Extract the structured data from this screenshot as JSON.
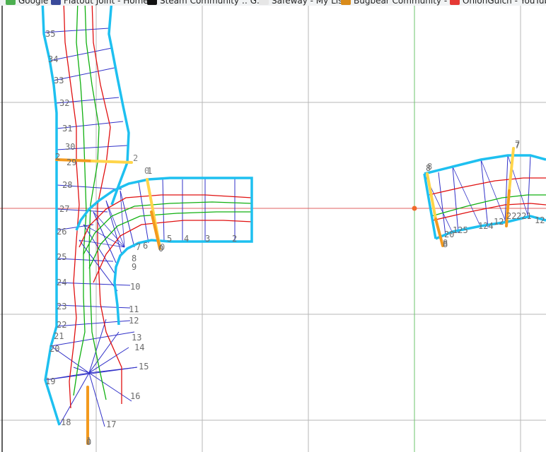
{
  "bookmarks": [
    {
      "label": "Google",
      "icon": "google-icon",
      "color": "#4caf50"
    },
    {
      "label": "Flatout Joint - Home",
      "icon": "flatout-icon",
      "color": "#3a4a9a"
    },
    {
      "label": "Steam Community :: G...",
      "icon": "steam-icon",
      "color": "#111111"
    },
    {
      "label": "Safeway - My List",
      "icon": "safeway-icon",
      "color": "#e6e6e6"
    },
    {
      "label": "Bugbear Community - ...",
      "icon": "bugbear-icon",
      "color": "#d98b1a"
    },
    {
      "label": "OnionGulch - YouTube",
      "icon": "youtube-icon",
      "color": "#e53935"
    }
  ],
  "colors": {
    "grid": "#b7b7b7",
    "axis_x": "#e06060",
    "axis_y": "#6cc46c",
    "outline": "#1ec0f0",
    "ribs": "#3030c8",
    "lane_red": "#e01010",
    "lane_green": "#10b010",
    "marker_dark": "#f39a1e",
    "marker_light": "#ffd54a",
    "origin": "#f06a2a"
  },
  "labels": {
    "left_road": [
      "35",
      "34",
      "33",
      "32",
      "31",
      "30",
      "2",
      "29",
      "28",
      "27",
      "26",
      "25",
      "24",
      "23",
      "22",
      "21",
      "20",
      "19",
      "18",
      "17",
      "16",
      "15",
      "14",
      "13",
      "12",
      "11",
      "10",
      "9",
      "8",
      "7",
      "6",
      "5",
      "4",
      "3",
      "2",
      "1",
      "0",
      "0",
      "1"
    ],
    "right_road": [
      "7",
      "8",
      "8",
      "20",
      "125",
      "124",
      "12",
      "22",
      "221",
      "12"
    ],
    "markers": [
      "2",
      "0",
      "0",
      "8",
      "7",
      "8",
      "1"
    ]
  }
}
